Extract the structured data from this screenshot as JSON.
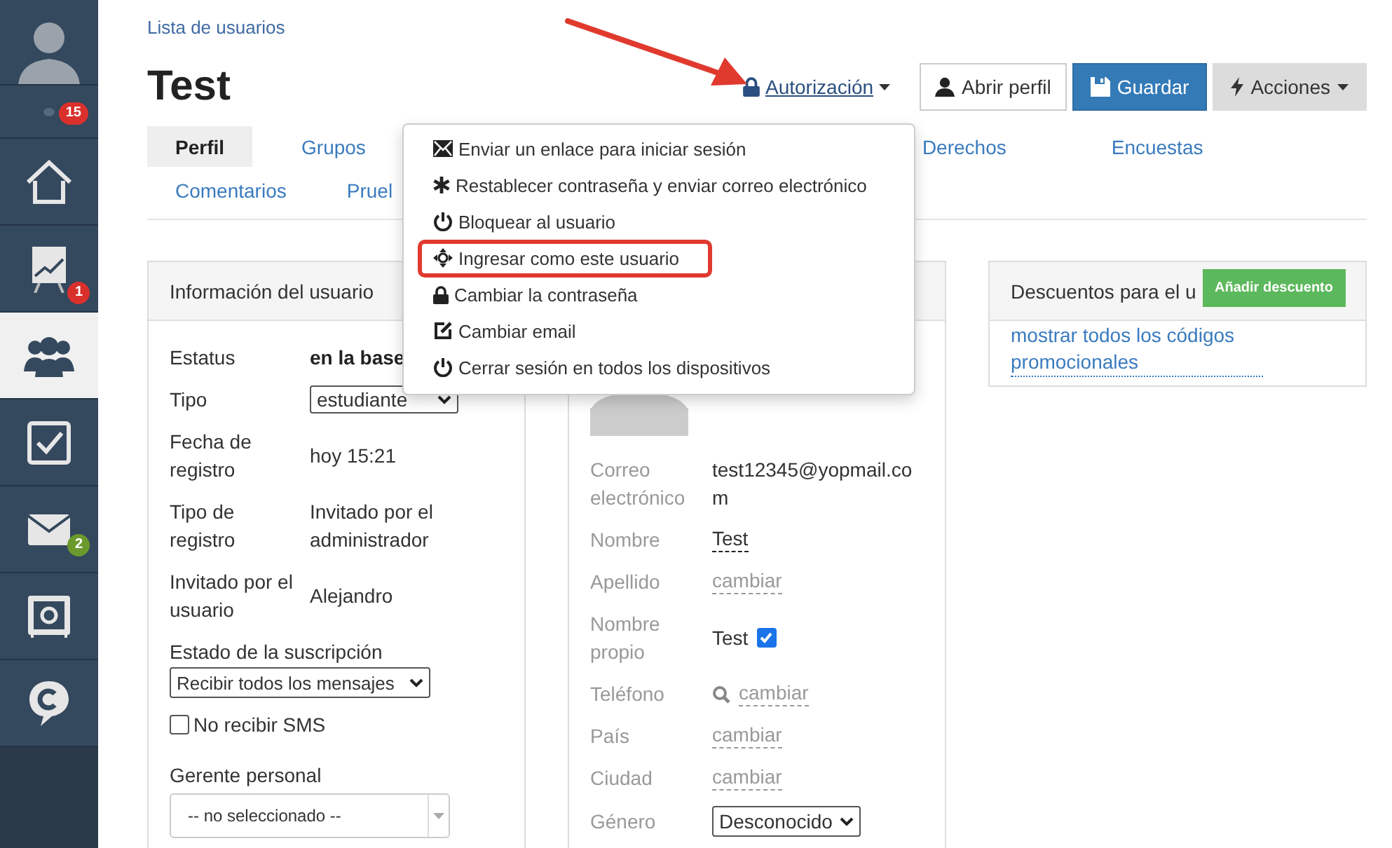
{
  "sidebar": {
    "items": [
      {
        "kind": "avatar",
        "selected": false
      },
      {
        "kind": "notifications",
        "selected": false,
        "badge": "15",
        "color": "#d9302c"
      },
      {
        "kind": "home",
        "selected": false
      },
      {
        "kind": "chart",
        "selected": false,
        "badge": "1",
        "color": "#d9302c"
      },
      {
        "kind": "users",
        "selected": true
      },
      {
        "kind": "check",
        "selected": false
      },
      {
        "kind": "mail",
        "selected": false,
        "badge": "2",
        "color": "#6b9a2c"
      },
      {
        "kind": "safe",
        "selected": false
      },
      {
        "kind": "chat",
        "selected": false
      }
    ]
  },
  "breadcrumb": "Lista de usuarios",
  "title": "Test",
  "header_actions": {
    "authorization": "Autorización",
    "open_profile": "Abrir perfil",
    "save": "Guardar",
    "actions": "Acciones"
  },
  "tab_rows": [
    [
      {
        "label": "Perfil",
        "selected": true
      },
      {
        "label": "Grupos",
        "selected": false
      },
      {
        "label": "Derechos",
        "selected": false
      },
      {
        "label": "Encuestas",
        "selected": false
      }
    ],
    [
      {
        "label": "Comentarios",
        "selected": false
      },
      {
        "label": "Pruel",
        "selected": false
      }
    ]
  ],
  "user_info": {
    "title": "Información del usuario",
    "rows": [
      {
        "kind": "text",
        "label": "Estatus",
        "value": "en la base",
        "bold": true
      },
      {
        "kind": "select",
        "label": "Tipo",
        "value": "estudiante"
      },
      {
        "kind": "text",
        "label": "Fecha de registro",
        "value": "hoy 15:21",
        "bold": false
      },
      {
        "kind": "text",
        "label": "Tipo de registro",
        "value": "Invitado por el administrador",
        "bold": false
      },
      {
        "kind": "text",
        "label": "Invitado por el usuario",
        "value": "Alejandro",
        "bold": false
      }
    ],
    "subscription": {
      "label": "Estado de la suscripción",
      "value": "Recibir todos los mensajes"
    },
    "sms": {
      "label": "No recibir SMS",
      "checked": false
    },
    "manager": {
      "label": "Gerente personal",
      "placeholder": "-- no seleccionado --"
    }
  },
  "profile": {
    "rows": [
      {
        "kind": "text",
        "label": "Correo electrónico",
        "value": "test12345@yopmail.com"
      },
      {
        "kind": "editable",
        "label": "Nombre",
        "value": "Test"
      },
      {
        "kind": "link",
        "label": "Apellido",
        "value": "cambiar"
      },
      {
        "kind": "checkbox",
        "label": "Nombre propio",
        "value": "Test",
        "checked": true
      },
      {
        "kind": "search_link",
        "label": "Teléfono",
        "value": "cambiar"
      },
      {
        "kind": "link",
        "label": "País",
        "value": "cambiar"
      },
      {
        "kind": "link",
        "label": "Ciudad",
        "value": "cambiar"
      },
      {
        "kind": "select",
        "label": "Género",
        "value": "Desconocido"
      }
    ]
  },
  "discounts": {
    "title": "Descuentos para el u",
    "add_button": "Añadir descuento",
    "link": "mostrar todos los códigos promocionales"
  },
  "authorization_menu": [
    {
      "kind": "envelope",
      "label": "Enviar un enlace para iniciar sesión",
      "highlighted": false
    },
    {
      "kind": "asterisk",
      "label": "Restablecer contraseña y enviar correo electrónico",
      "highlighted": false
    },
    {
      "kind": "power",
      "label": "Bloquear al usuario",
      "highlighted": false
    },
    {
      "kind": "move",
      "label": "Ingresar como este usuario",
      "highlighted": true
    },
    {
      "kind": "lock",
      "label": "Cambiar la contraseña",
      "highlighted": false
    },
    {
      "kind": "edit",
      "label": "Cambiar email",
      "highlighted": false
    },
    {
      "kind": "power",
      "label": "Cerrar sesión en todos los dispositivos",
      "highlighted": false
    }
  ]
}
